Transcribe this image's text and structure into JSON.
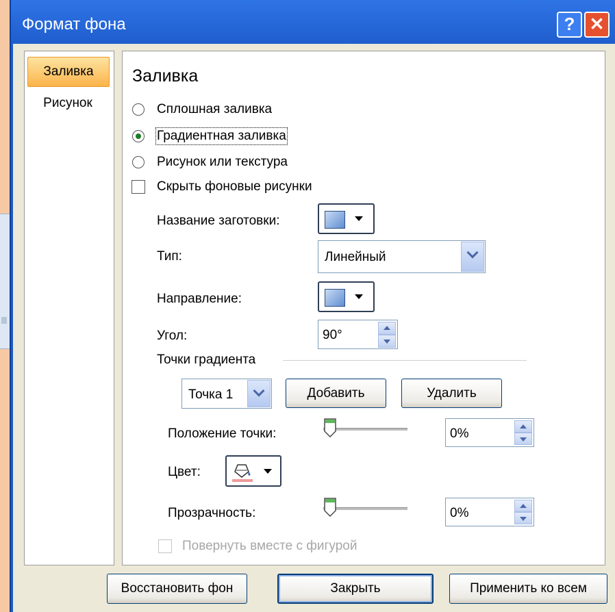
{
  "window": {
    "title": "Формат фона",
    "help_glyph": "?",
    "close_glyph": "✕"
  },
  "nav": {
    "items": [
      "Заливка",
      "Рисунок"
    ],
    "selected": "Заливка"
  },
  "fill": {
    "section_title": "Заливка",
    "options": [
      "Сплошная заливка",
      "Градиентная заливка",
      "Рисунок или текстура"
    ],
    "selected_option": "Градиентная заливка",
    "hide_bg_label": "Скрыть фоновые рисунки",
    "hide_bg_checked": false,
    "preset_label": "Название заготовки:",
    "type_label": "Тип:",
    "type_value": "Линейный",
    "direction_label": "Направление:",
    "angle_label": "Угол:",
    "angle_value": "90°",
    "stops_title": "Точки градиента",
    "stop_value": "Точка 1",
    "add_label": "Добавить",
    "remove_label": "Удалить",
    "position_label": "Положение точки:",
    "position_value": "0%",
    "position_level": 0,
    "color_label": "Цвет:",
    "transparency_label": "Прозрачность:",
    "transparency_value": "0%",
    "transparency_level": 0,
    "rotate_label": "Повернуть вместе с фигурой",
    "rotate_enabled": false
  },
  "buttons": {
    "reset": "Восстановить фон",
    "close": "Закрыть",
    "apply_all": "Применить ко всем"
  },
  "colors": {
    "title_bar": "#1f5cc4",
    "nav_selected": "#fbb44a",
    "radio_dot": "#1e7d22",
    "slider_thumb": "#5fb85a"
  }
}
